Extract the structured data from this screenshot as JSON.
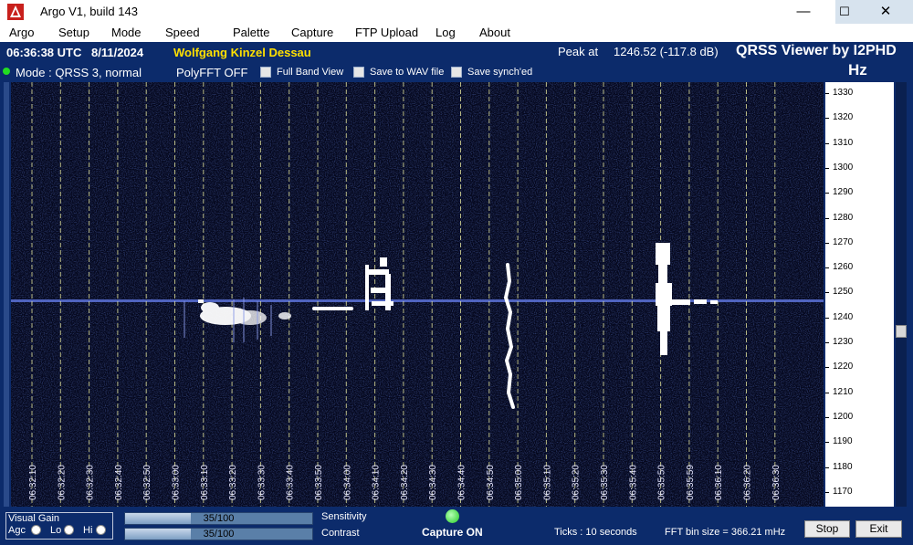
{
  "window": {
    "title": "Argo V1, build 143",
    "buttons": {
      "minimize": "—",
      "maximize": "☐",
      "close": "✕"
    }
  },
  "menu": [
    "Argo",
    "Setup",
    "Mode",
    "Speed",
    "Palette",
    "Capture",
    "FTP Upload",
    "Log",
    "About"
  ],
  "header": {
    "time": "06:36:38 UTC",
    "date": "8/11/2024",
    "callsign": "Wolfgang Kinzel Dessau",
    "peak_label": "Peak at",
    "peak_value": "1246.52 (-117.8 dB)",
    "brand": "QRSS Viewer by I2PHD",
    "unit": "Hz"
  },
  "options": {
    "mode": "Mode : QRSS 3, normal",
    "polyfft": "PolyFFT OFF",
    "full_band": "Full Band View",
    "save_wav": "Save to WAV file",
    "save_sync": "Save synch'ed"
  },
  "freq_axis": {
    "unit": "Hz",
    "labels": [
      "1330",
      "1320",
      "1310",
      "1300",
      "1290",
      "1280",
      "1270",
      "1260",
      "1250",
      "1240",
      "1230",
      "1220",
      "1210",
      "1200",
      "1190",
      "1180",
      "1170"
    ],
    "values": [
      1330,
      1320,
      1310,
      1300,
      1290,
      1280,
      1270,
      1260,
      1250,
      1240,
      1230,
      1220,
      1210,
      1200,
      1190,
      1180,
      1170
    ]
  },
  "time_axis": {
    "labels": [
      "06:32:10",
      "06:32:20",
      "06:32:30",
      "06:32:40",
      "06:32:50",
      "06:33:00",
      "06:33:10",
      "06:33:20",
      "06:33:30",
      "06:33:40",
      "06:33:50",
      "06:34:00",
      "06:34:10",
      "06:34:20",
      "06:34:30",
      "06:34:40",
      "06:34:50",
      "06:35:00",
      "06:35:10",
      "06:35:20",
      "06:35:30",
      "06:35:40",
      "06:35:50",
      "06:35:59",
      "06:36:10",
      "06:36:20",
      "06:36:30"
    ]
  },
  "footer": {
    "visual_gain": "Visual Gain",
    "agc": "Agc",
    "lo": "Lo",
    "hi": "Hi",
    "sensitivity_value": "35/100",
    "sensitivity_fraction": 0.35,
    "sensitivity_label": "Sensitivity",
    "contrast_value": "35/100",
    "contrast_fraction": 0.35,
    "contrast_label": "Contrast",
    "capture": "Capture ON",
    "ticks": "Ticks  : 10 seconds",
    "fft_bin": "FFT bin size = 366.21 mHz",
    "stop": "Stop",
    "exit": "Exit"
  },
  "colors": {
    "panel": "#0c2b6b",
    "callsign": "#ffe000",
    "capture_led": "#22dd22",
    "waterfall_bg": "#05081e",
    "signal": "#ffffff"
  }
}
